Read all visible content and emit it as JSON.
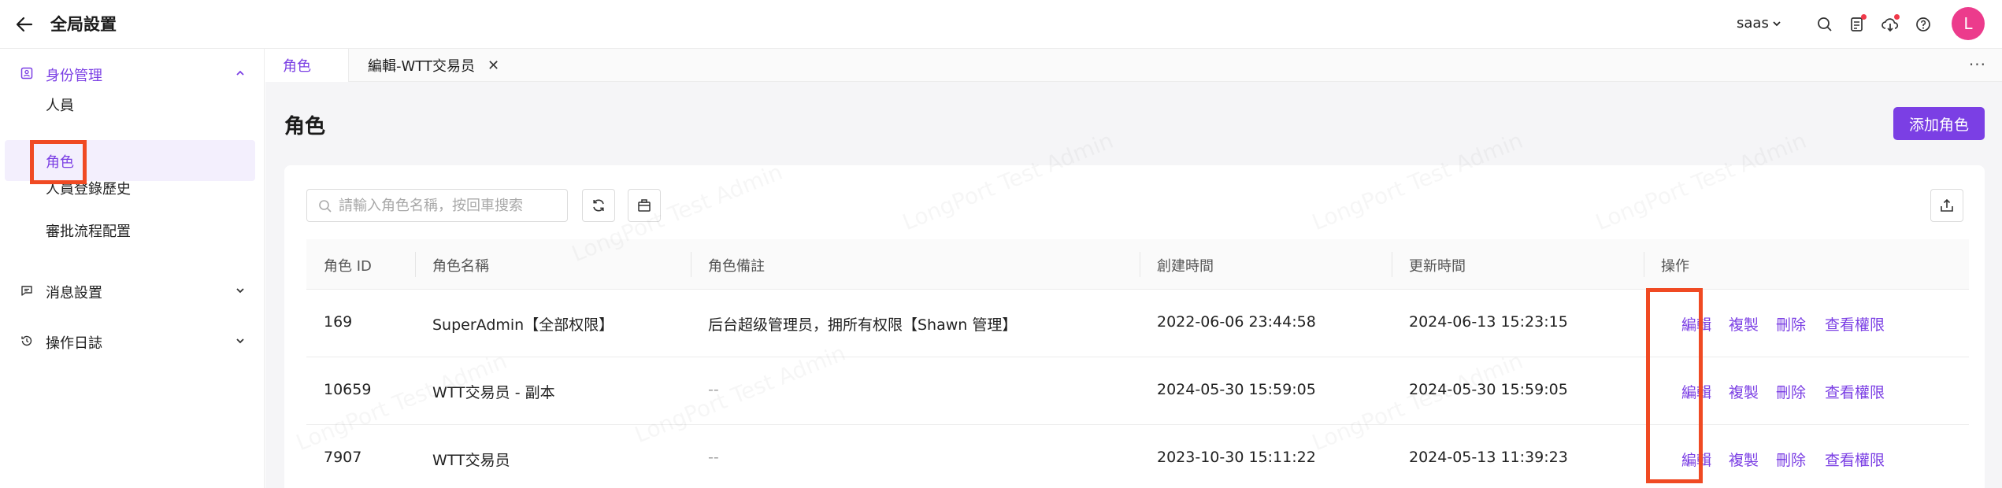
{
  "header": {
    "title": "全局設置",
    "tenant": "saas",
    "avatar_initial": "L",
    "icons": [
      "search-icon",
      "task-icon",
      "download-icon",
      "help-icon"
    ]
  },
  "sidebar": {
    "groups": [
      {
        "label": "身份管理",
        "icon": "id-card-icon",
        "expanded": true,
        "items": [
          {
            "label": "人員"
          },
          {
            "label": "角色",
            "active": true
          },
          {
            "label": "人員登錄歷史"
          },
          {
            "label": "審批流程配置"
          }
        ]
      },
      {
        "label": "消息設置",
        "icon": "message-icon",
        "expanded": false
      },
      {
        "label": "操作日誌",
        "icon": "history-icon",
        "expanded": false
      }
    ]
  },
  "tabs": [
    {
      "label": "角色",
      "active": true
    },
    {
      "label": "編輯-WTT交易员",
      "closable": true
    }
  ],
  "main": {
    "title": "角色",
    "add_button": "添加角色",
    "search_placeholder": "請輸入角色名稱，按回車搜索",
    "watermark": "LongPort Test Admin"
  },
  "table": {
    "columns": [
      "角色 ID",
      "角色名稱",
      "角色備註",
      "創建時間",
      "更新時間",
      "操作"
    ],
    "rows": [
      {
        "id": "169",
        "name": "SuperAdmin【全部权限】",
        "remark": "后台超级管理员，拥所有权限【Shawn 管理】",
        "created": "2022-06-06 23:44:58",
        "updated": "2024-06-13 15:23:15"
      },
      {
        "id": "10659",
        "name": "WTT交易员 - 副本",
        "remark": "--",
        "created": "2024-05-30 15:59:05",
        "updated": "2024-05-30 15:59:05"
      },
      {
        "id": "7907",
        "name": "WTT交易员",
        "remark": "--",
        "created": "2023-10-30 15:11:22",
        "updated": "2024-05-13 11:39:23"
      }
    ],
    "actions": [
      "編輯",
      "複製",
      "刪除",
      "查看權限"
    ]
  },
  "colors": {
    "accent": "#7b3fe4",
    "highlight": "#f04a23",
    "avatar": "#ec3b8c"
  }
}
